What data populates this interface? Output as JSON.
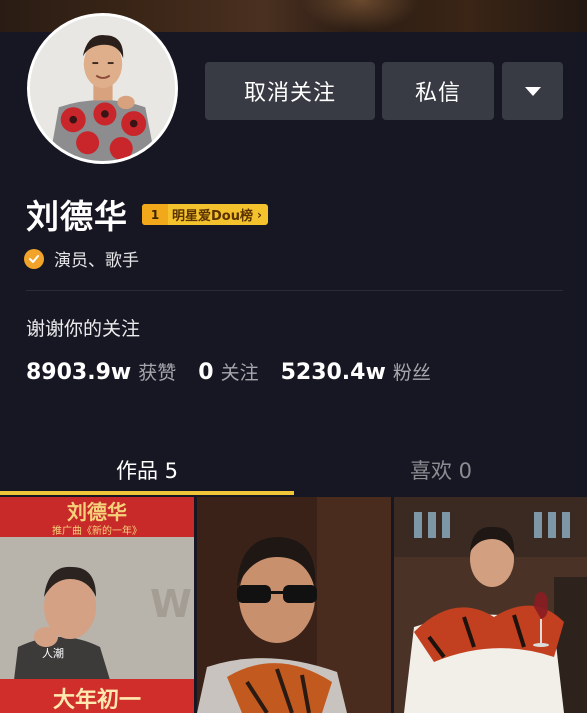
{
  "profile": {
    "name": "刘德华",
    "rank_badge": {
      "number": "1",
      "label": "明星爱Dou榜",
      "arrow": "›"
    },
    "verification": "演员、歌手",
    "bio": "谢谢你的关注"
  },
  "actions": {
    "unfollow_label": "取消关注",
    "message_label": "私信",
    "more_icon": "caret-down-icon"
  },
  "stats": [
    {
      "value": "8903.9w",
      "label": "获赞"
    },
    {
      "value": "0",
      "label": "关注"
    },
    {
      "value": "5230.4w",
      "label": "粉丝"
    }
  ],
  "tabs": [
    {
      "label": "作品 5",
      "active": true
    },
    {
      "label": "喜欢 0",
      "active": false
    }
  ],
  "videos": [
    {
      "title_text": "刘德华",
      "subtitle_text": "推广曲《新的一年》",
      "bottom_text": "大年初一",
      "tag_text": "人潮"
    },
    {
      "description": "man-with-sunglasses-scarf"
    },
    {
      "description": "man-with-wine-glass"
    }
  ],
  "colors": {
    "background": "#161722",
    "button": "#393b44",
    "accent": "#f0c53a",
    "badge": "#f4c22c",
    "verified": "#f2a32a"
  }
}
